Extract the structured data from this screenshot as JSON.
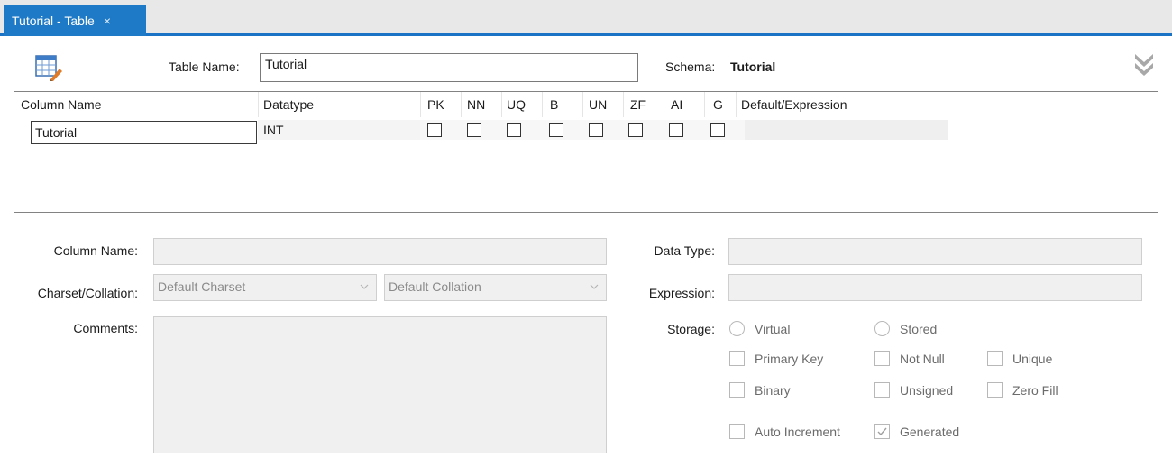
{
  "tab": {
    "label": "Tutorial - Table",
    "close_glyph": "×"
  },
  "header": {
    "table_name_label": "Table Name:",
    "table_name_value": "Tutorial",
    "schema_label": "Schema:",
    "schema_value": "Tutorial"
  },
  "grid": {
    "headers": [
      "Column Name",
      "Datatype",
      "PK",
      "NN",
      "UQ",
      "B",
      "UN",
      "ZF",
      "AI",
      "G",
      "Default/Expression"
    ],
    "rows": [
      {
        "column_name": "Tutorial",
        "datatype": "INT",
        "flags": [
          false,
          false,
          false,
          false,
          false,
          false,
          false,
          false
        ],
        "default": ""
      }
    ]
  },
  "details": {
    "column_name_label": "Column Name:",
    "column_name_value": "",
    "charset_label": "Charset/Collation:",
    "charset_value": "Default Charset",
    "collation_value": "Default Collation",
    "comments_label": "Comments:",
    "data_type_label": "Data Type:",
    "expression_label": "Expression:",
    "storage_label": "Storage:",
    "options": {
      "virtual": "Virtual",
      "stored": "Stored",
      "primary_key": "Primary Key",
      "not_null": "Not Null",
      "unique": "Unique",
      "binary": "Binary",
      "unsigned": "Unsigned",
      "zero_fill": "Zero Fill",
      "auto_increment": "Auto Increment",
      "generated": "Generated"
    },
    "generated_checked": true
  },
  "icons": {
    "table": "table-edit-icon",
    "collapse": "double-chevron-down-icon",
    "dropdown": "chevron-down-icon"
  },
  "colors": {
    "tab_accent": "#1e7ac6",
    "tab_underline": "#1a73c4",
    "disabled_bg": "#f0f0f0"
  }
}
